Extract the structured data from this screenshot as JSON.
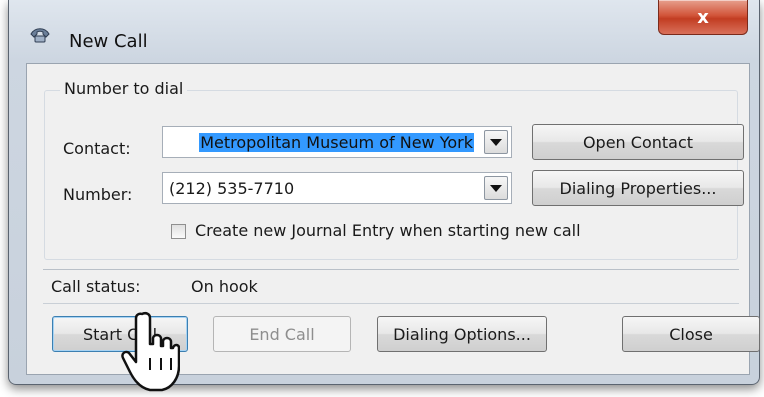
{
  "window": {
    "title": "New Call",
    "close_glyph": "x"
  },
  "group": {
    "label": "Number to dial"
  },
  "contact": {
    "label": "Contact:",
    "value": "Metropolitan Museum of New York",
    "highlight_color": "#3399ff"
  },
  "number": {
    "label": "Number:",
    "value": "(212) 535-7710"
  },
  "buttons": {
    "open_contact": "Open Contact",
    "dialing_properties": "Dialing Properties...",
    "start_call": "Start Call",
    "end_call": "End Call",
    "dialing_options": "Dialing Options...",
    "close": "Close"
  },
  "journal_checkbox": {
    "label": "Create new Journal Entry when starting new call",
    "checked": false
  },
  "status": {
    "label": "Call status:",
    "value": "On hook"
  },
  "icons": {
    "title_icon": "phone-icon",
    "cursor": "hand-pointer-icon"
  }
}
